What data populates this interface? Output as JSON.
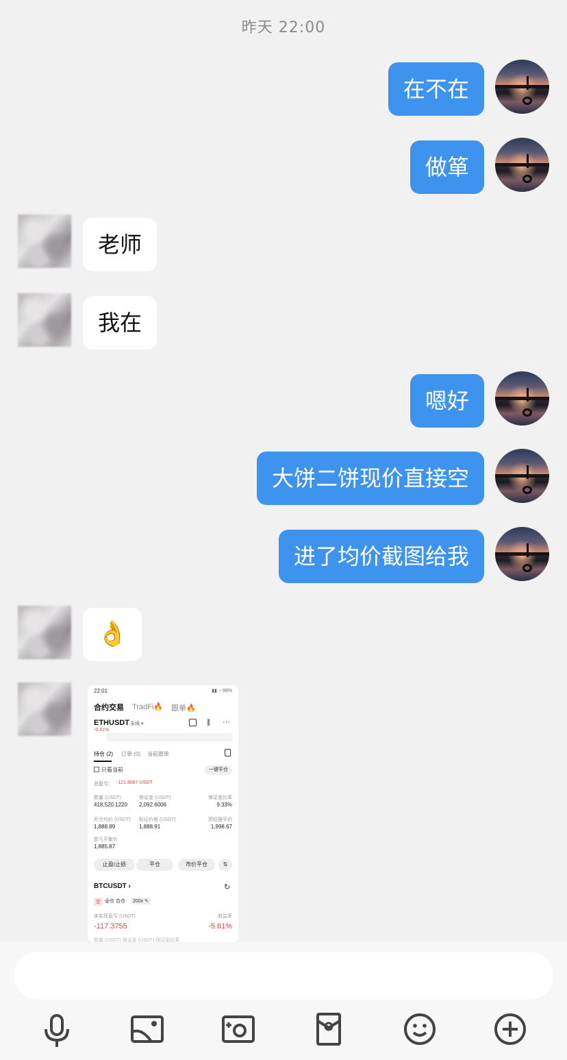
{
  "chat": {
    "timestamp": "昨天 22:00",
    "messages": [
      {
        "from": "me",
        "text": "在不在"
      },
      {
        "from": "me",
        "text": "做箪"
      },
      {
        "from": "them",
        "text": "老师"
      },
      {
        "from": "them",
        "text": "我在"
      },
      {
        "from": "me",
        "text": "嗯好"
      },
      {
        "from": "me",
        "text": "大饼二饼现价直接空"
      },
      {
        "from": "me",
        "text": "进了均价截图给我"
      },
      {
        "from": "them",
        "text": "👌"
      }
    ]
  },
  "screenshot": {
    "status_time": "22:01",
    "status_icons": "▮▮ ◔ 99%",
    "tabs": [
      "合约交易",
      "TradFi🔥",
      "跟单🔥"
    ],
    "symbol": "ETHUSDT",
    "perpetual": "永续 ▾",
    "change": "-0.41%",
    "sub_tabs": [
      "持仓 (2)",
      "订单 (0)",
      "当前跟单"
    ],
    "only_current": "只看当前",
    "close_all": "一键平仓",
    "total_pnl_label": "总盈亏：",
    "total_pnl_value": "-121.8067 USDT",
    "eth": {
      "size_label": "数量 (USDT)",
      "size_value": "418,520.1220",
      "margin_label": "保证金 (USDT)",
      "margin_value": "2,092.6006",
      "margin_ratio_label": "保证金比率",
      "margin_ratio_value": "9.33%",
      "entry_label": "开仓均价 (USDT)",
      "entry_value": "1,888.89",
      "mark_label": "标记价格 (USDT)",
      "mark_value": "1,888.91",
      "liq_label": "预估强平价",
      "liq_value": "1,998.67",
      "breakeven_label": "盈亏平衡价",
      "breakeven_value": "1,885.87"
    },
    "buttons": [
      "止盈/止损",
      "平仓",
      "市价平仓",
      "⇅"
    ],
    "btc_symbol": "BTCUSDT  ›",
    "btc_side": "空",
    "btc_mode": "全仓 合仓",
    "btc_leverage": "200x ✎",
    "btc_upnl_label": "未实现盈亏 (USDT)",
    "btc_upnl_value": "-117.3755",
    "btc_roe_label": "收益率",
    "btc_roe_value": "-5.61%",
    "btc_cut_text": "数量 (USDT)        保证金 (USDT)            保证金比率"
  },
  "input": {
    "placeholder": ""
  },
  "toolbar": {
    "icons": [
      "microphone-icon",
      "image-icon",
      "camera-icon",
      "red-packet-icon",
      "emoji-icon",
      "plus-icon"
    ]
  },
  "colors": {
    "my_bubble": "#3d93ed",
    "their_bubble": "#ffffff",
    "background": "#f1f1f1",
    "loss_red": "#e04848"
  }
}
